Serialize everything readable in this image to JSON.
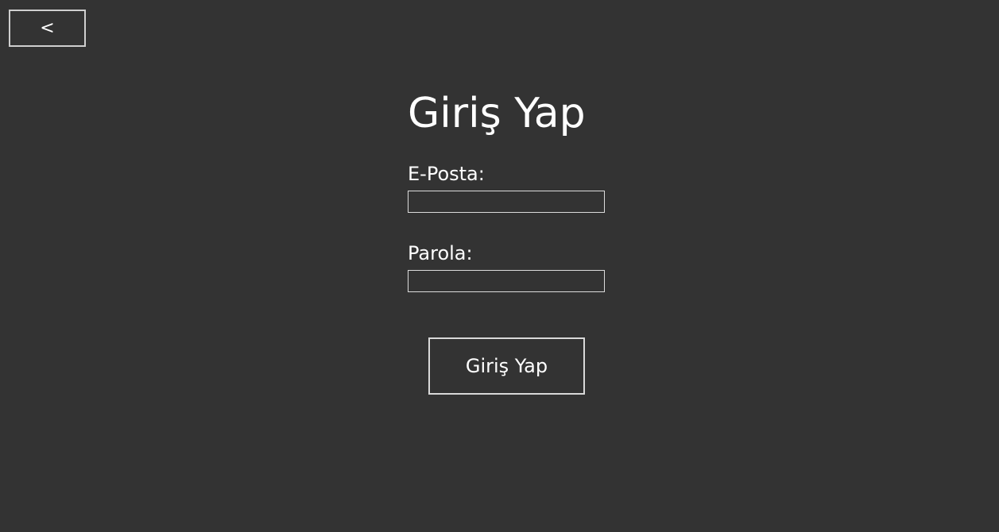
{
  "navigation": {
    "back_label": "<"
  },
  "login": {
    "title": "Giriş Yap",
    "email_label": "E-Posta:",
    "email_value": "",
    "password_label": "Parola:",
    "password_value": "",
    "submit_label": "Giriş Yap"
  },
  "colors": {
    "background": "#333333",
    "text": "#ffffff",
    "border": "#d9d9d9"
  }
}
